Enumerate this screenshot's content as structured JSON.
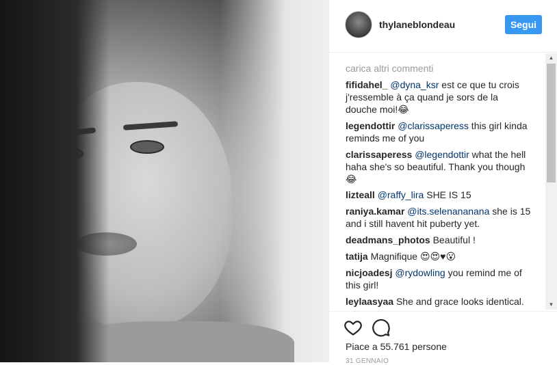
{
  "post": {
    "username": "thylaneblondeau",
    "follow_label": "Segui",
    "likes_text": "Piace a 55.761 persone",
    "date": "31 GENNAIO"
  },
  "comments_section": {
    "load_more": "carica altri commenti",
    "items": [
      {
        "user": "fifidahel_",
        "mention": "@dyna_ksr",
        "text": " est ce que tu crois j'ressemble à ça quand je sors de la douche moi!😂"
      },
      {
        "user": "legendottir",
        "mention": "@clarissaperess",
        "text": " this girl kinda reminds me of you"
      },
      {
        "user": "clarissaperess",
        "mention": "@legendottir",
        "text": " what the hell haha she's so beautiful. Thank you though 😂"
      },
      {
        "user": "lizteall",
        "mention": "@raffy_lira",
        "text": " SHE IS 15"
      },
      {
        "user": "raniya.kamar",
        "mention": "@its.selenananana",
        "text": " she is 15 and i still havent hit puberty yet."
      },
      {
        "user": "deadmans_photos",
        "mention": "",
        "text": "Beautiful !"
      },
      {
        "user": "tatija",
        "mention": "",
        "text": "Magnifique 😍😍♥😮"
      },
      {
        "user": "nicjoadesj",
        "mention": "@rydowling",
        "text": " you remind me of this girl!"
      },
      {
        "user": "leylaasyaa",
        "mention": "",
        "text": "She and grace looks identical."
      }
    ]
  },
  "icons": {
    "like": "heart-icon",
    "comment": "comment-bubble-icon"
  },
  "colors": {
    "follow_button": "#3897f0",
    "mention": "#003569",
    "muted": "#999999"
  }
}
